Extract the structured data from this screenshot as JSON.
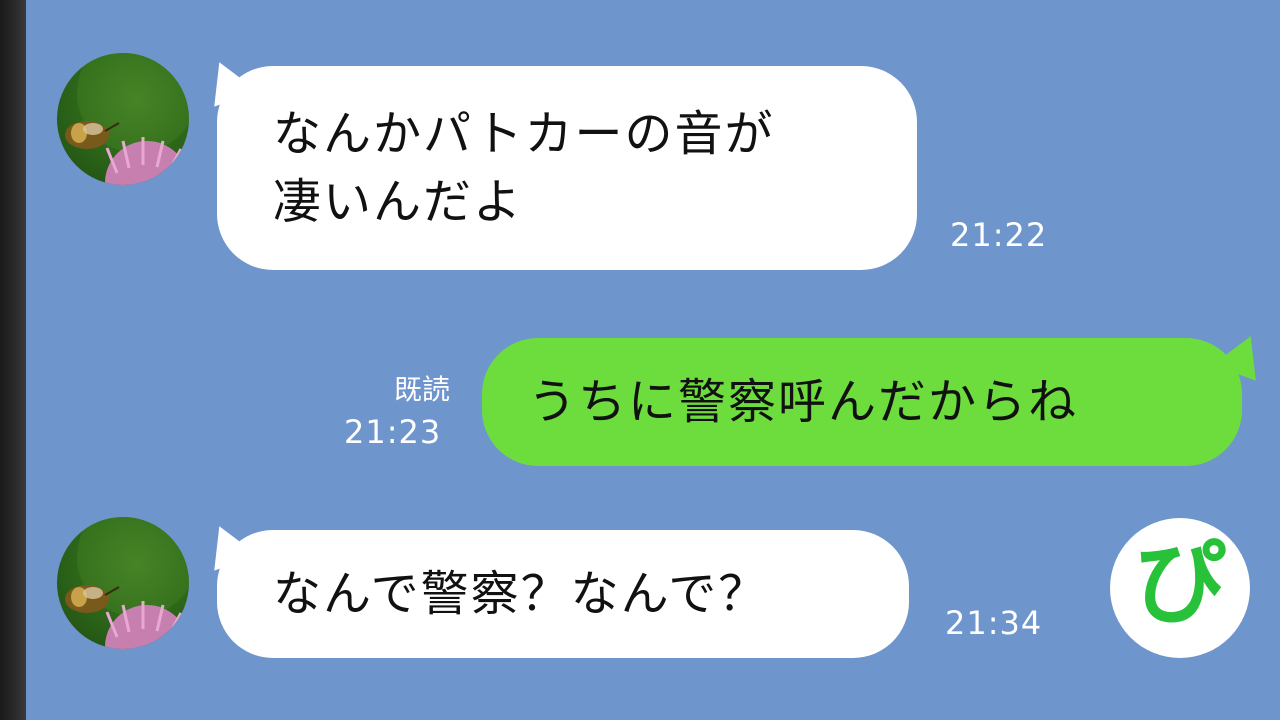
{
  "messages": [
    {
      "direction": "incoming",
      "lines": [
        "なんかパトカーの音が",
        "凄いんだよ"
      ],
      "time": "21:22"
    },
    {
      "direction": "outgoing",
      "text": "うちに警察呼んだからね",
      "read_label": "既読",
      "time": "21:23"
    },
    {
      "direction": "incoming",
      "text": "なんで警察？なんで？",
      "time": "21:34"
    }
  ],
  "avatar": {
    "icon": "bee-on-flower-avatar"
  },
  "badge": {
    "text": "ぴ",
    "color": "#28c23a"
  },
  "colors": {
    "background": "#6f95cd",
    "incoming_bubble": "#ffffff",
    "outgoing_bubble": "#6ddd3e"
  }
}
